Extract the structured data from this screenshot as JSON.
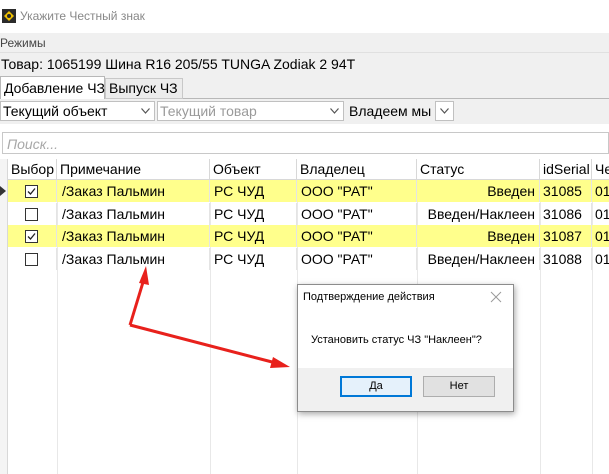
{
  "window": {
    "title": "Укажите Честный знак"
  },
  "menu": {
    "items": [
      {
        "label": "Режимы"
      }
    ]
  },
  "product": {
    "text": "Товар: 1065199  Шина R16 205/55 TUNGA Zodiak 2 94T"
  },
  "tabs": [
    {
      "label": "Добавление ЧЗ"
    },
    {
      "label": "Выпуск ЧЗ"
    }
  ],
  "filters": {
    "object_value": "Текущий объект",
    "product_value": "Текущий товар",
    "owner_label": "Владеем мы"
  },
  "search": {
    "placeholder": "Поиск..."
  },
  "table": {
    "columns": [
      "Выбор",
      "Примечание",
      "Объект",
      "Владелец",
      "Статус",
      "idSerial",
      "Че"
    ],
    "rows": [
      {
        "checked": true,
        "note": "/Заказ Пальмин",
        "object": "РС ЧУД",
        "owner": "ООО \"РАТ\"",
        "status": "Введен",
        "id": "31085",
        "extra": "01",
        "highlighted": true
      },
      {
        "checked": false,
        "note": "/Заказ Пальмин",
        "object": "РС ЧУД",
        "owner": "ООО \"РАТ\"",
        "status": "Введен/Наклеен",
        "id": "31086",
        "extra": "01",
        "highlighted": false
      },
      {
        "checked": true,
        "note": "/Заказ Пальмин",
        "object": "РС ЧУД",
        "owner": "ООО \"РАТ\"",
        "status": "Введен",
        "id": "31087",
        "extra": "01",
        "highlighted": true
      },
      {
        "checked": false,
        "note": "/Заказ Пальмин",
        "object": "РС ЧУД",
        "owner": "ООО \"РАТ\"",
        "status": "Введен/Наклеен",
        "id": "31088",
        "extra": "01",
        "highlighted": false
      }
    ]
  },
  "dialog": {
    "title": "Подтверждение действия",
    "message": "Установить статус ЧЗ \"Наклеен\"?",
    "yes_label": "Да",
    "no_label": "Нет"
  },
  "colors": {
    "row_highlight": "#ffff8c",
    "annotation_arrow": "#e8211c",
    "default_button_border": "#0078d7"
  }
}
